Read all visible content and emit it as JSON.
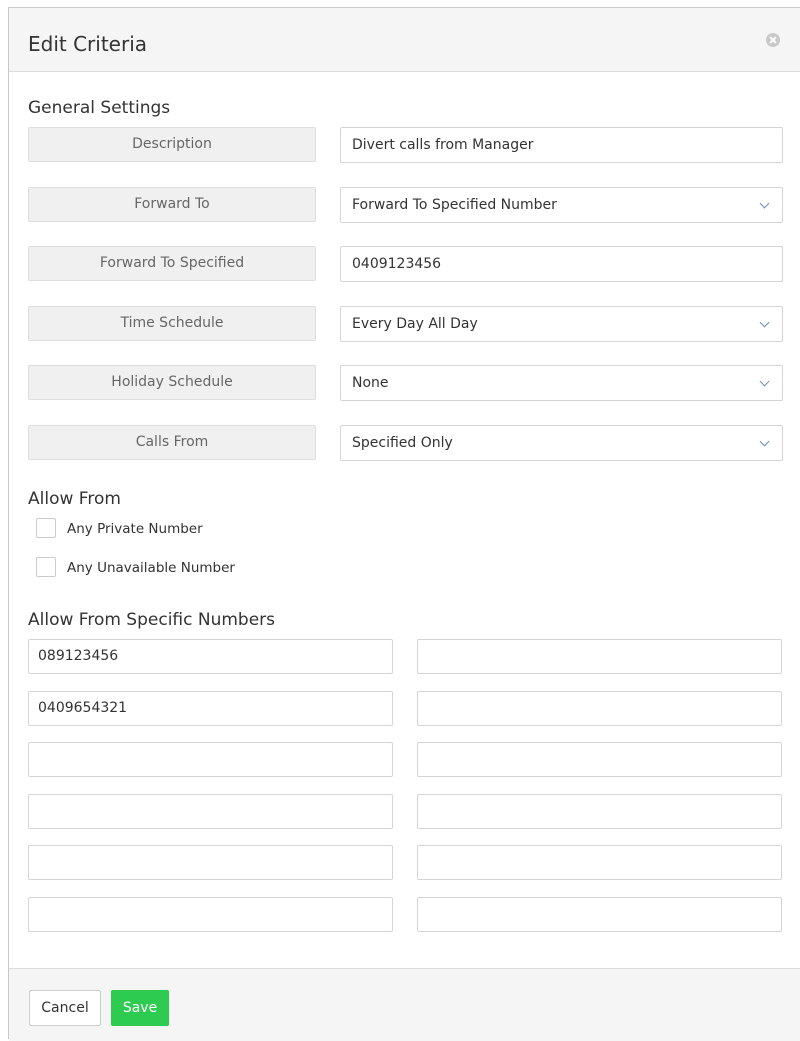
{
  "dialog": {
    "title": "Edit Criteria"
  },
  "general": {
    "heading": "General Settings",
    "rows": [
      {
        "label": "Description",
        "value": "Divert calls from Manager",
        "type": "input"
      },
      {
        "label": "Forward To",
        "value": "Forward To Specified Number",
        "type": "select"
      },
      {
        "label": "Forward To Specified",
        "value": "0409123456",
        "type": "input"
      },
      {
        "label": "Time Schedule",
        "value": "Every Day All Day",
        "type": "select"
      },
      {
        "label": "Holiday Schedule",
        "value": "None",
        "type": "select"
      },
      {
        "label": "Calls From",
        "value": "Specified Only",
        "type": "select"
      }
    ]
  },
  "allow_from": {
    "heading": "Allow From",
    "options": [
      {
        "label": "Any Private Number",
        "checked": false
      },
      {
        "label": "Any Unavailable Number",
        "checked": false
      }
    ]
  },
  "specific_numbers": {
    "heading": "Allow From Specific Numbers",
    "values": [
      "089123456",
      "",
      "0409654321",
      "",
      "",
      "",
      "",
      "",
      "",
      "",
      "",
      ""
    ]
  },
  "footer": {
    "cancel_label": "Cancel",
    "save_label": "Save"
  },
  "colors": {
    "save_button": "#2dcb50",
    "chevron": "#6a8fb8"
  }
}
